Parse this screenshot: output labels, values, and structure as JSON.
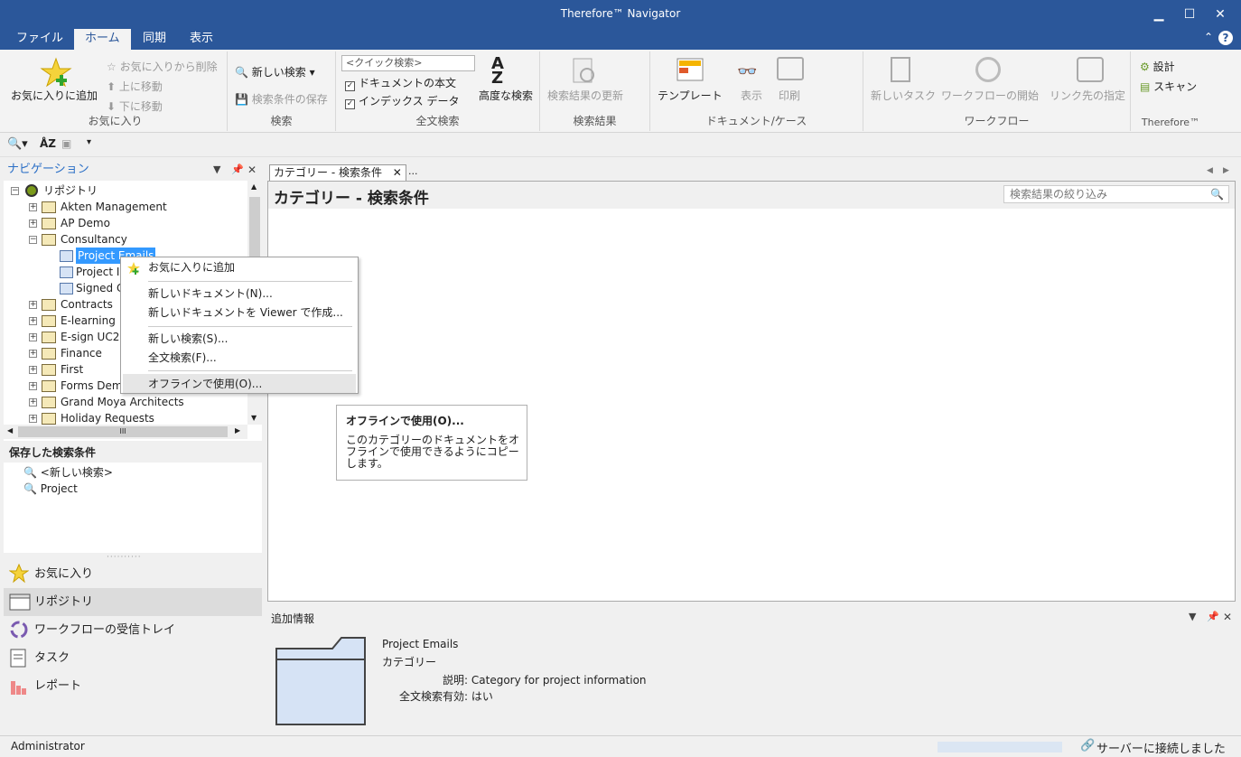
{
  "window": {
    "title": "Therefore™ Navigator",
    "minimize": "▁",
    "maximize": "☐",
    "close": "✕"
  },
  "menu": {
    "tabs": [
      "ファイル",
      "ホーム",
      "同期",
      "表示"
    ],
    "active": 1,
    "collapse": "⌃",
    "help": "?"
  },
  "ribbon": {
    "favorites": {
      "add_label": "お気に入りに追加",
      "remove_label": "お気に入りから削除",
      "move_up": "上に移動",
      "move_down": "下に移動",
      "group": "お気に入り"
    },
    "search": {
      "new_search": "新しい検索",
      "save_conditions": "検索条件の保存",
      "group": "検索"
    },
    "fulltext": {
      "quick_placeholder": "<クイック検索>",
      "doc_body": "ドキュメントの本文",
      "index_data": "インデックス データ",
      "advanced": "高度な検索",
      "group": "全文検索"
    },
    "results": {
      "refresh": "検索結果の更新",
      "group": "検索結果"
    },
    "doccase": {
      "template": "テンプレート",
      "view": "表示",
      "print": "印刷",
      "group": "ドキュメント/ケース"
    },
    "workflow": {
      "new_task": "新しいタスク",
      "start_workflow": "ワークフローの開始",
      "link_target": "リンク先の指定",
      "group": "ワークフロー"
    },
    "therefore": {
      "design": "設計",
      "scan": "スキャン",
      "group": "Therefore™"
    }
  },
  "navigation": {
    "title": "ナビゲーション",
    "tree": [
      {
        "label": "リポジトリ",
        "level": 0,
        "type": "root",
        "expanded": true
      },
      {
        "label": "Akten Management",
        "level": 1,
        "type": "folder",
        "expanded": false
      },
      {
        "label": "AP Demo",
        "level": 1,
        "type": "folder",
        "expanded": false
      },
      {
        "label": "Consultancy",
        "level": 1,
        "type": "folder",
        "expanded": true
      },
      {
        "label": "Project Emails",
        "level": 2,
        "type": "category",
        "selected": true
      },
      {
        "label": "Project In",
        "level": 2,
        "type": "category"
      },
      {
        "label": "Signed C",
        "level": 2,
        "type": "category"
      },
      {
        "label": "Contracts",
        "level": 1,
        "type": "folder",
        "expanded": false
      },
      {
        "label": "E-learning",
        "level": 1,
        "type": "folder",
        "expanded": false
      },
      {
        "label": "E-sign UC2",
        "level": 1,
        "type": "folder",
        "expanded": false
      },
      {
        "label": "Finance",
        "level": 1,
        "type": "folder",
        "expanded": false
      },
      {
        "label": "First",
        "level": 1,
        "type": "folder",
        "expanded": false
      },
      {
        "label": "Forms Demo",
        "level": 1,
        "type": "folder",
        "expanded": false
      },
      {
        "label": "Grand Moya Architects",
        "level": 1,
        "type": "folder",
        "expanded": false
      },
      {
        "label": "Holiday Requests",
        "level": 1,
        "type": "folder",
        "expanded": false
      }
    ],
    "hscroll_grip": "III"
  },
  "saved_searches": {
    "title": "保存した検索条件",
    "items": [
      "<新しい検索>",
      "Project"
    ]
  },
  "nav_buttons": [
    {
      "label": "お気に入り",
      "icon": "star-icon"
    },
    {
      "label": "リポジトリ",
      "icon": "repository-icon",
      "active": true
    },
    {
      "label": "ワークフローの受信トレイ",
      "icon": "workflow-inbox-icon"
    },
    {
      "label": "タスク",
      "icon": "task-icon"
    },
    {
      "label": "レポート",
      "icon": "report-icon"
    }
  ],
  "document": {
    "tab_label": "カテゴリー - 検索条件",
    "tab_more": "...",
    "header": "カテゴリー - 検索条件",
    "filter_placeholder": "検索結果の絞り込み"
  },
  "context_menu": {
    "items": [
      "お気に入りに追加",
      "新しいドキュメント(N)...",
      "新しいドキュメントを Viewer で作成...",
      "新しい検索(S)...",
      "全文検索(F)...",
      "オフラインで使用(O)..."
    ],
    "hovered": 5
  },
  "tooltip": {
    "title": "オフラインで使用(O)...",
    "body": "このカテゴリーのドキュメントをオフラインで使用できるようにコピーします。"
  },
  "additional_info": {
    "title": "追加情報",
    "name": "Project Emails",
    "type": "カテゴリー",
    "desc_label": "説明:",
    "desc_value": "Category for project information",
    "fulltext_label": "全文検索有効:",
    "fulltext_value": "はい"
  },
  "status": {
    "user": "Administrator",
    "connection": "サーバーに接続しました"
  }
}
